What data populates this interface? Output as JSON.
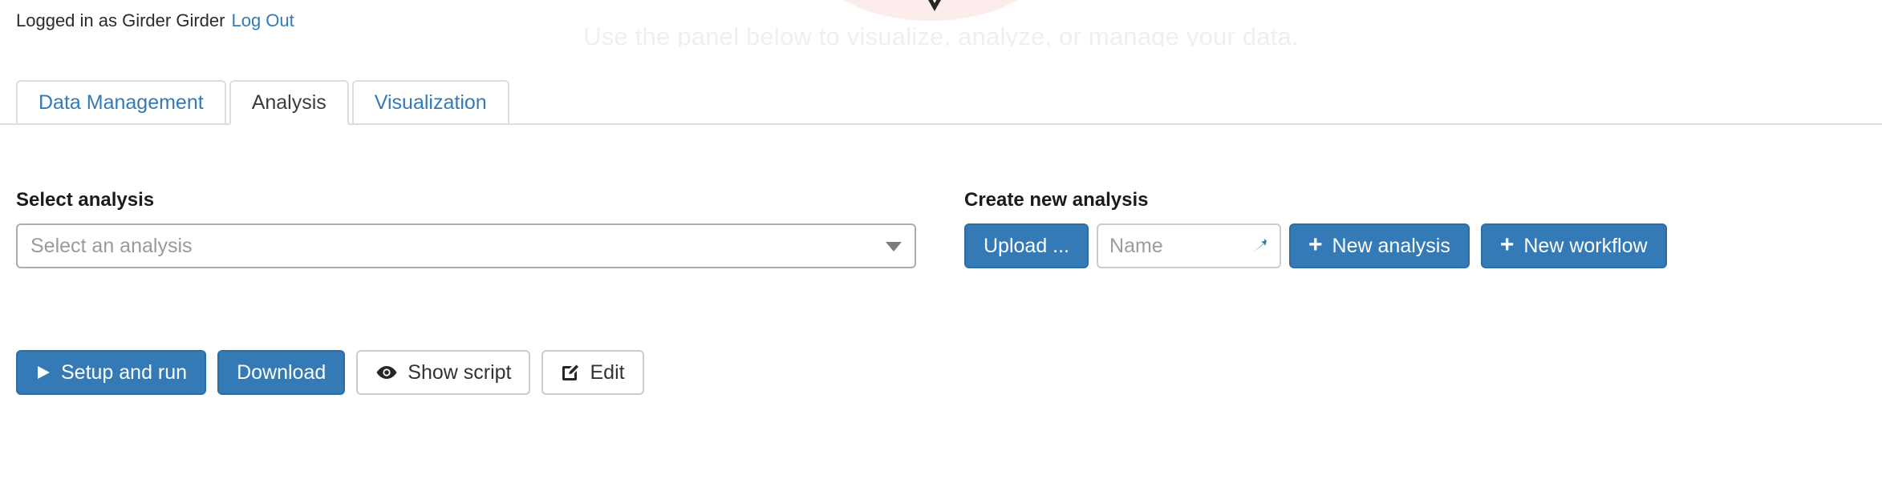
{
  "banner": {
    "subtitle": "Use the panel below to visualize, analyze, or manage your data.",
    "chevron_icon": "chevron-down-icon",
    "accent_color": "#fbe9e7"
  },
  "session": {
    "logged_in_text": "Logged in as Girder Girder",
    "logout_label": "Log Out",
    "link_color": "#337ab7"
  },
  "tabs": [
    {
      "label": "Data Management",
      "active": false
    },
    {
      "label": "Analysis",
      "active": true
    },
    {
      "label": "Visualization",
      "active": false
    }
  ],
  "select_analysis": {
    "label": "Select analysis",
    "placeholder": "Select an analysis",
    "value": "",
    "arrow_icon": "caret-down-icon"
  },
  "create_new_analysis": {
    "label": "Create new analysis",
    "upload_label": "Upload ...",
    "name_placeholder": "Name",
    "name_value": "",
    "name_icon": "spark-glyph-icon",
    "name_icon_color": "#2b7a8c",
    "new_analysis_label": "New analysis",
    "new_workflow_label": "New workflow",
    "plus_glyph": "+"
  },
  "actions": [
    {
      "label": "Setup and run",
      "style": "primary",
      "icon": "play-icon"
    },
    {
      "label": "Download",
      "style": "primary",
      "icon": ""
    },
    {
      "label": "Show script",
      "style": "default",
      "icon": "eye-icon"
    },
    {
      "label": "Edit",
      "style": "default",
      "icon": "pencil-square-icon"
    }
  ],
  "colors": {
    "primary": "#337ab7",
    "primary_border": "#2e6da4",
    "default_border": "#cccccc",
    "tab_border": "#dddddd",
    "muted_text": "#9a9a9a"
  }
}
